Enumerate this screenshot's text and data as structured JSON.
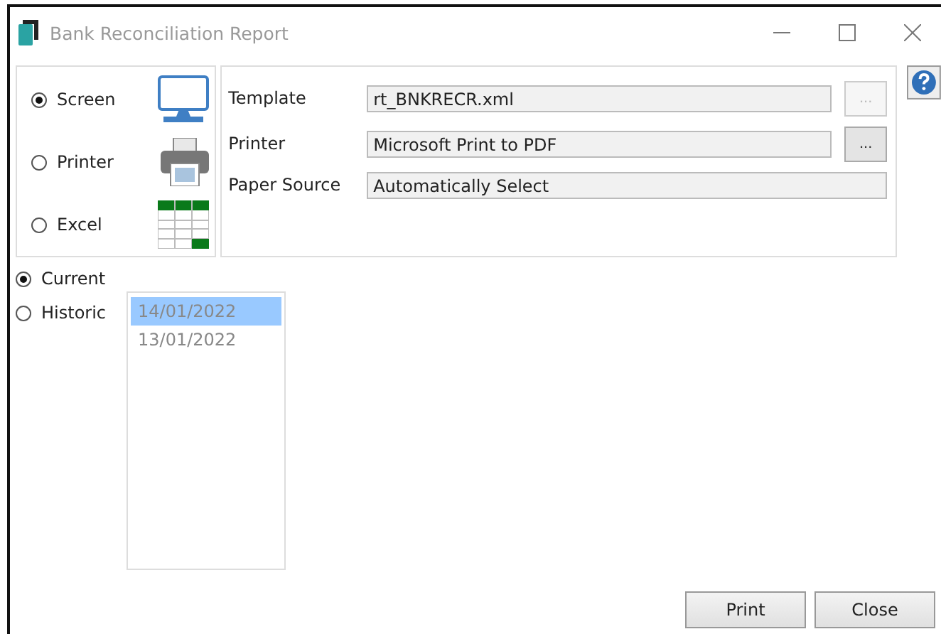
{
  "window": {
    "title": "Bank Reconciliation Report"
  },
  "output_options": [
    {
      "label": "Screen",
      "kind": "screen",
      "selected": true
    },
    {
      "label": "Printer",
      "kind": "printer",
      "selected": false
    },
    {
      "label": "Excel",
      "kind": "excel",
      "selected": false
    }
  ],
  "settings": [
    {
      "label": "Template",
      "value": "rt_BNKRECR.xml",
      "browse": {
        "label": "...",
        "disabled": true
      }
    },
    {
      "label": "Printer",
      "value": "Microsoft Print to PDF",
      "browse": {
        "label": "...",
        "disabled": false
      }
    },
    {
      "label": "Paper Source",
      "value": "Automatically Select"
    }
  ],
  "period_options": [
    {
      "label": "Current",
      "selected": true
    },
    {
      "label": "Historic",
      "selected": false
    }
  ],
  "history_list": [
    {
      "label": "14/01/2022",
      "selected": true
    },
    {
      "label": "13/01/2022",
      "selected": false
    }
  ],
  "buttons": [
    "Print",
    "Close"
  ]
}
